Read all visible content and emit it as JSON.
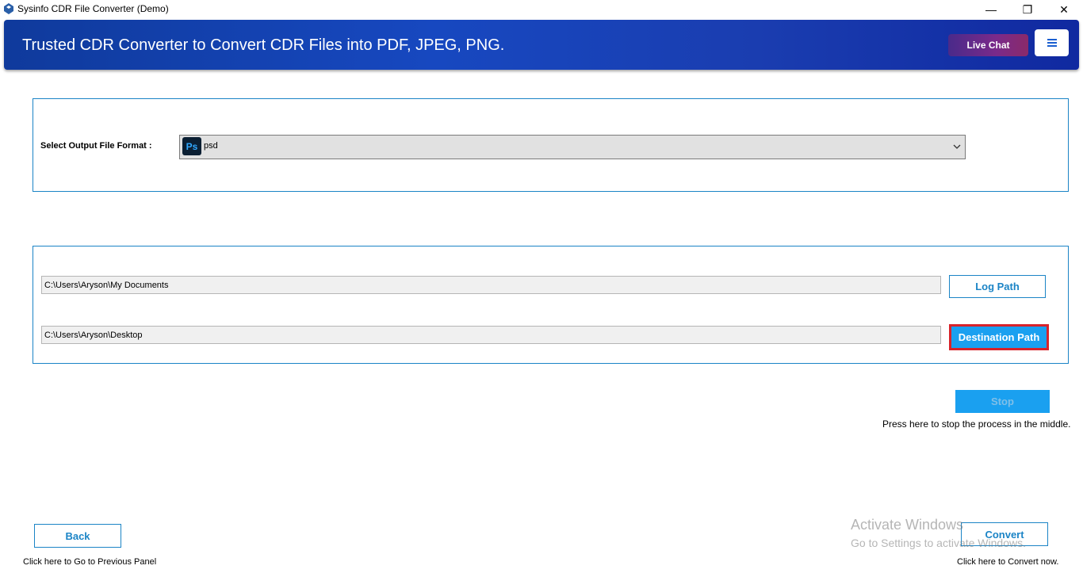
{
  "window": {
    "title": "Sysinfo CDR File Converter (Demo)",
    "controls": {
      "minimize": "—",
      "maximize": "❐",
      "close": "✕"
    }
  },
  "header": {
    "title": "Trusted CDR Converter to Convert CDR Files into PDF, JPEG, PNG.",
    "live_chat_label": "Live Chat",
    "menu_icon": "hamburger-menu-icon"
  },
  "format_section": {
    "label": "Select Output File Format :",
    "selected_icon_text": "Ps",
    "selected_value": "psd"
  },
  "paths": {
    "log_path_value": "C:\\Users\\Aryson\\My Documents",
    "log_path_button": "Log Path",
    "destination_path_value": "C:\\Users\\Aryson\\Desktop",
    "destination_path_button": "Destination Path"
  },
  "stop": {
    "label": "Stop",
    "hint": "Press here to stop the process in the middle."
  },
  "navigation": {
    "back_label": "Back",
    "back_hint": "Click here to Go to Previous Panel",
    "convert_label": "Convert",
    "convert_hint": "Click here to Convert now."
  },
  "watermark": {
    "title": "Activate Windows",
    "subtitle": "Go to Settings to activate Windows."
  },
  "colors": {
    "accent": "#1b84c6",
    "button_fill": "#1aa0f0",
    "highlight_border": "#d8232a",
    "banner": "#1748c0"
  }
}
